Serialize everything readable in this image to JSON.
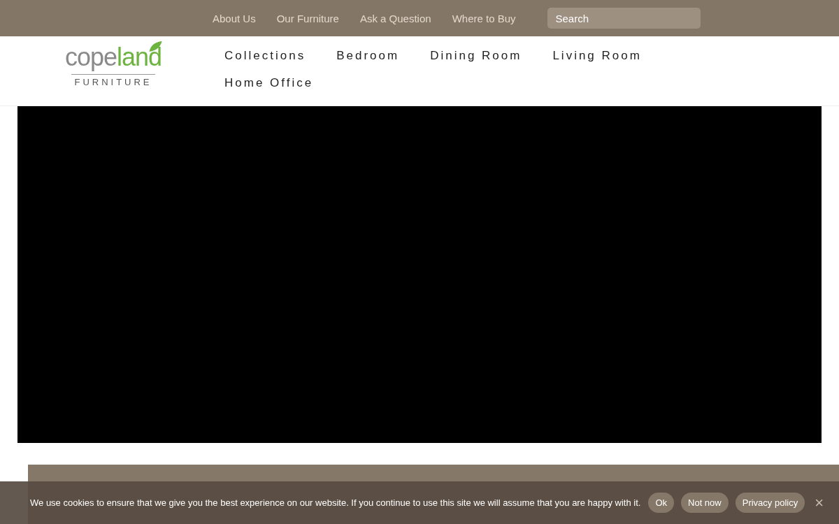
{
  "top_nav": {
    "links": [
      "About Us",
      "Our Furniture",
      "Ask a Question",
      "Where to Buy"
    ],
    "search": {
      "placeholder": "Search"
    }
  },
  "header": {
    "logo": {
      "word_left": "cope",
      "word_right": "land",
      "subtitle": "FURNITURE"
    },
    "menu": [
      "Collections",
      "Bedroom",
      "Dining Room",
      "Living Room",
      "Home Office"
    ]
  },
  "hero": {
    "kind": "video"
  },
  "cookie_bar": {
    "message": "We use cookies to ensure that we give you the best experience on our website. If you continue to use this site we will assume that you are happy with it.",
    "buttons": [
      "Ok",
      "Not now",
      "Privacy policy"
    ],
    "close": "×"
  }
}
